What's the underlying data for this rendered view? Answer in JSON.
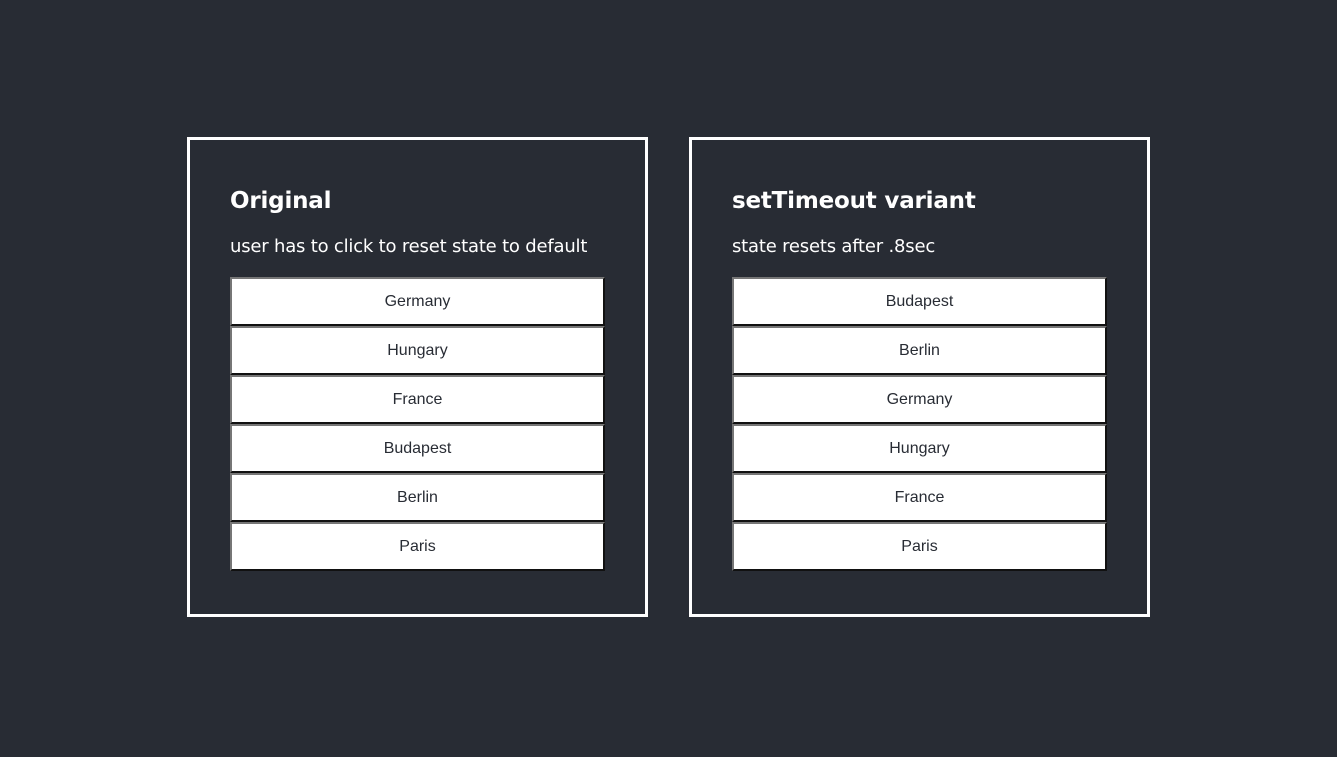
{
  "panels": [
    {
      "title": "Original",
      "subtitle": "user has to click to reset state to default",
      "options": [
        "Germany",
        "Hungary",
        "France",
        "Budapest",
        "Berlin",
        "Paris"
      ]
    },
    {
      "title": "setTimeout variant",
      "subtitle": "state resets after .8sec",
      "options": [
        "Budapest",
        "Berlin",
        "Germany",
        "Hungary",
        "France",
        "Paris"
      ]
    }
  ],
  "colors": {
    "background": "#282c34",
    "panel_border": "#ffffff",
    "button_background": "#ffffff",
    "button_text": "#282c34"
  }
}
